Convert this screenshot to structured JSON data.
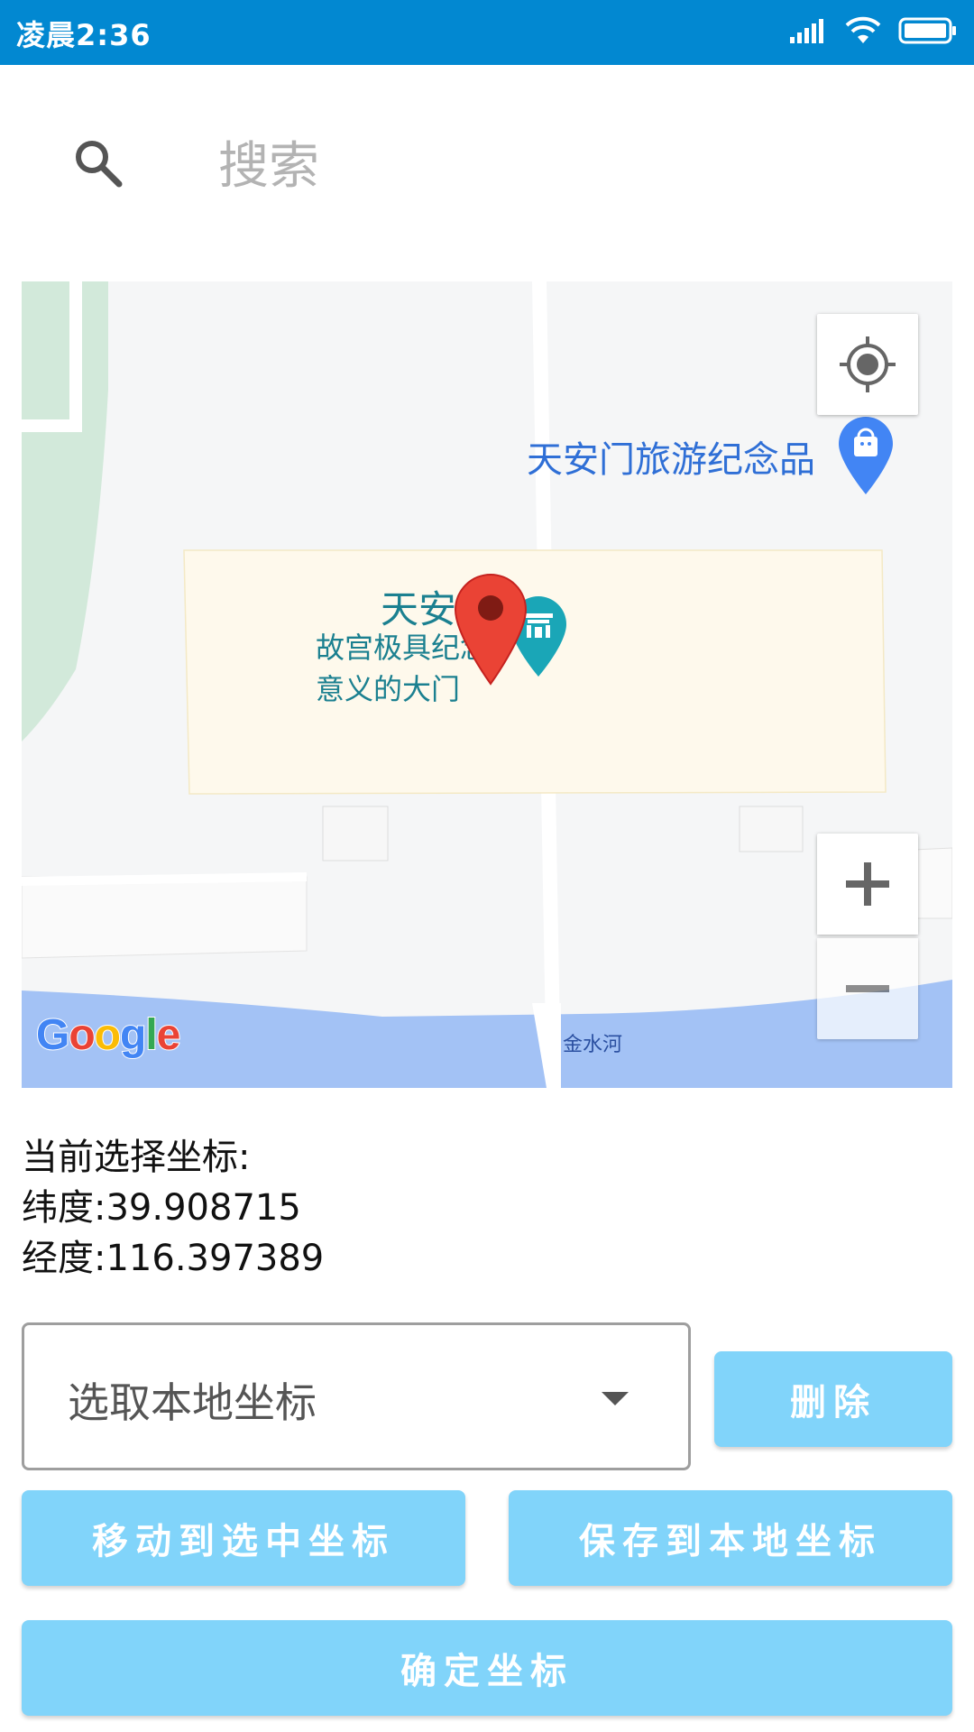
{
  "status_bar": {
    "time": "凌晨2:36",
    "icons": [
      "signal-icon",
      "wifi-icon",
      "battery-icon"
    ],
    "background": "#0288d1"
  },
  "search": {
    "placeholder": "搜索",
    "value": ""
  },
  "map": {
    "poi_gate_title": "天安",
    "poi_gate_desc_line1": "故宫极具纪念",
    "poi_gate_desc_line2": "意义的大门",
    "poi_shop": "天安门旅游纪念品",
    "river": "金水河",
    "google_logo": [
      "G",
      "o",
      "o",
      "g",
      "l",
      "e"
    ],
    "google_colors": [
      "#4285f4",
      "#ea4335",
      "#fbbc05",
      "#4285f4",
      "#34a853",
      "#ea4335"
    ],
    "marker_color": "#ea4335"
  },
  "coords": {
    "heading": "当前选择坐标:",
    "latitude_label": "纬度:",
    "latitude": "39.908715",
    "longitude_label": "经度:",
    "longitude": "116.397389"
  },
  "controls": {
    "select_value": "选取本地坐标",
    "delete_label": "删除",
    "move_label": "移动到选中坐标",
    "save_label": "保存到本地坐标",
    "confirm_label": "确定坐标",
    "button_color": "#81d4fa"
  }
}
